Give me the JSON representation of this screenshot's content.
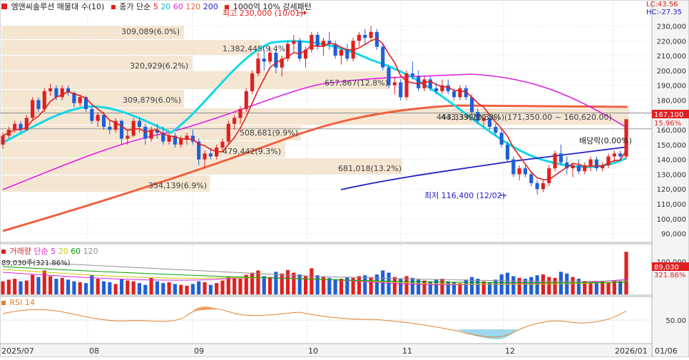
{
  "header": {
    "title": "엠앤씨솔루션 매물대 수(10)",
    "ma_label": "종가 단순",
    "ma_periods": [
      "5",
      "20",
      "60",
      "120",
      "200"
    ],
    "ma_colors": [
      "#e02020",
      "#00d0e0",
      "#e020e0",
      "#f08050",
      "#2020d0"
    ],
    "pattern_label": "1000억 10% 강세패턴"
  },
  "corner": {
    "lc": "LC:43.56",
    "hc": "HC:-27.35"
  },
  "price_axis_ticks": [
    "230,000",
    "220,000",
    "210,000",
    "200,000",
    "190,000",
    "180,000",
    "170,000",
    "160,000",
    "150,000",
    "140,000",
    "130,000",
    "120,000",
    "110,000",
    "100,000",
    "90,000"
  ],
  "last_price": {
    "label": "167,100",
    "pct": "15.96%"
  },
  "annotations": {
    "high": "최고 230,000 (10/01)",
    "low": "최저 116,400 (12/02)",
    "dividend": "배당락(0.00%)",
    "current_box": "443,339(20.3%)(171,350.00 ~ 160,620.00)"
  },
  "volume_profile": [
    {
      "label": "309,089(6.0%)"
    },
    {
      "label": "1,382,445(9.4%)"
    },
    {
      "label": "320,929(6.2%)"
    },
    {
      "label": "657,867(12.8%)"
    },
    {
      "label": "309,879(6.0%)"
    },
    {
      "label": "443,339(20.3%)"
    },
    {
      "label": "508,681(9.9%)"
    },
    {
      "label": "479,442(9.3%)"
    },
    {
      "label": "681,018(13.2%)"
    },
    {
      "label": "354,139(6.9%)"
    }
  ],
  "volume_panel": {
    "title": "거래량",
    "ma_label": "단순",
    "ma_periods": [
      "5",
      "20",
      "60",
      "120"
    ],
    "ma_colors": [
      "#e020e0",
      "#d0d000",
      "#00a000",
      "#909090"
    ],
    "info": "89,030주(321.86%)",
    "axis_label": "100,000",
    "value_label": "89,030",
    "pct_label": "321.86%"
  },
  "rsi_panel": {
    "title": "RSI 14",
    "axis_label": "50.00"
  },
  "x_axis": {
    "labels": [
      "2025/07",
      "08",
      "09",
      "10",
      "11",
      "12",
      "2026/01",
      "01/06"
    ]
  },
  "chart_data": {
    "type": "candlestick",
    "title": "엠앤씨솔루션",
    "ylim": [
      85000,
      236000
    ],
    "high": {
      "value": 230000,
      "date": "10/01"
    },
    "low": {
      "value": 116400,
      "date": "12/02"
    },
    "last_close": 167100,
    "last_change_pct": 15.96,
    "volume_profile_levels": [
      {
        "volume": 309089,
        "pct": 6.0
      },
      {
        "volume": 1382445,
        "pct": 9.4
      },
      {
        "volume": 320929,
        "pct": 6.2
      },
      {
        "volume": 657867,
        "pct": 12.8
      },
      {
        "volume": 309879,
        "pct": 6.0
      },
      {
        "volume": 443339,
        "pct": 20.3,
        "range": [
          160620,
          171350
        ]
      },
      {
        "volume": 508681,
        "pct": 9.9
      },
      {
        "volume": 479442,
        "pct": 9.3
      },
      {
        "volume": 681018,
        "pct": 13.2
      },
      {
        "volume": 354139,
        "pct": 6.9
      }
    ],
    "last_volume": 89030,
    "last_volume_pct": 321.86,
    "candles": [
      [
        150000,
        158000,
        147000,
        156000
      ],
      [
        156000,
        162000,
        154000,
        160000
      ],
      [
        160000,
        166000,
        158000,
        164000
      ],
      [
        164000,
        166000,
        158000,
        160000
      ],
      [
        160000,
        170000,
        159000,
        168000
      ],
      [
        168000,
        182000,
        167000,
        180000
      ],
      [
        180000,
        182000,
        172000,
        174000
      ],
      [
        174000,
        188000,
        172000,
        186000
      ],
      [
        186000,
        191000,
        183000,
        188000
      ],
      [
        188000,
        190000,
        180000,
        182000
      ],
      [
        182000,
        190000,
        180000,
        188000
      ],
      [
        188000,
        190000,
        183000,
        185000
      ],
      [
        185000,
        186000,
        175000,
        178000
      ],
      [
        178000,
        184000,
        176000,
        182000
      ],
      [
        182000,
        183000,
        172000,
        174000
      ],
      [
        174000,
        176000,
        164000,
        166000
      ],
      [
        166000,
        172000,
        162000,
        170000
      ],
      [
        170000,
        172000,
        160000,
        162000
      ],
      [
        162000,
        166000,
        157000,
        160000
      ],
      [
        160000,
        168000,
        158000,
        166000
      ],
      [
        166000,
        167000,
        150000,
        154000
      ],
      [
        154000,
        160000,
        150000,
        156000
      ],
      [
        156000,
        168000,
        155000,
        166000
      ],
      [
        166000,
        168000,
        158000,
        162000
      ],
      [
        162000,
        164000,
        150000,
        154000
      ],
      [
        154000,
        162000,
        152000,
        160000
      ],
      [
        160000,
        164000,
        154000,
        158000
      ],
      [
        158000,
        162000,
        150000,
        152000
      ],
      [
        152000,
        158000,
        150000,
        156000
      ],
      [
        156000,
        158000,
        148000,
        150000
      ],
      [
        150000,
        156000,
        148000,
        154000
      ],
      [
        154000,
        158000,
        150000,
        156000
      ],
      [
        156000,
        160000,
        150000,
        152000
      ],
      [
        152000,
        154000,
        136000,
        140000
      ],
      [
        140000,
        146000,
        134000,
        144000
      ],
      [
        144000,
        148000,
        140000,
        142000
      ],
      [
        142000,
        150000,
        140000,
        148000
      ],
      [
        148000,
        154000,
        146000,
        152000
      ],
      [
        152000,
        166000,
        150000,
        164000
      ],
      [
        164000,
        170000,
        160000,
        168000
      ],
      [
        168000,
        176000,
        164000,
        174000
      ],
      [
        174000,
        188000,
        172000,
        186000
      ],
      [
        186000,
        200000,
        184000,
        198000
      ],
      [
        198000,
        212000,
        196000,
        208000
      ],
      [
        208000,
        214000,
        200000,
        206000
      ],
      [
        206000,
        216000,
        204000,
        212000
      ],
      [
        212000,
        214000,
        198000,
        202000
      ],
      [
        202000,
        210000,
        196000,
        208000
      ],
      [
        208000,
        220000,
        206000,
        218000
      ],
      [
        218000,
        224000,
        212000,
        220000
      ],
      [
        220000,
        222000,
        206000,
        208000
      ],
      [
        208000,
        216000,
        202000,
        214000
      ],
      [
        214000,
        226000,
        212000,
        224000
      ],
      [
        224000,
        226000,
        214000,
        216000
      ],
      [
        216000,
        222000,
        210000,
        220000
      ],
      [
        220000,
        226000,
        214000,
        218000
      ],
      [
        218000,
        220000,
        208000,
        210000
      ],
      [
        210000,
        216000,
        204000,
        214000
      ],
      [
        214000,
        218000,
        206000,
        208000
      ],
      [
        208000,
        222000,
        206000,
        220000
      ],
      [
        220000,
        226000,
        216000,
        224000
      ],
      [
        224000,
        228000,
        218000,
        222000
      ],
      [
        222000,
        230000,
        220000,
        226000
      ],
      [
        226000,
        228000,
        214000,
        216000
      ],
      [
        216000,
        218000,
        200000,
        202000
      ],
      [
        202000,
        204000,
        188000,
        190000
      ],
      [
        190000,
        196000,
        184000,
        192000
      ],
      [
        192000,
        194000,
        180000,
        182000
      ],
      [
        182000,
        200000,
        180000,
        198000
      ],
      [
        198000,
        206000,
        194000,
        196000
      ],
      [
        196000,
        200000,
        186000,
        188000
      ],
      [
        188000,
        196000,
        186000,
        194000
      ],
      [
        194000,
        196000,
        186000,
        188000
      ],
      [
        188000,
        192000,
        184000,
        186000
      ],
      [
        186000,
        194000,
        184000,
        190000
      ],
      [
        190000,
        194000,
        184000,
        186000
      ],
      [
        186000,
        188000,
        180000,
        182000
      ],
      [
        182000,
        190000,
        180000,
        188000
      ],
      [
        188000,
        190000,
        180000,
        182000
      ],
      [
        182000,
        184000,
        170000,
        172000
      ],
      [
        172000,
        174000,
        164000,
        166000
      ],
      [
        166000,
        170000,
        162000,
        168000
      ],
      [
        168000,
        170000,
        160000,
        162000
      ],
      [
        162000,
        164000,
        156000,
        158000
      ],
      [
        158000,
        160000,
        148000,
        150000
      ],
      [
        150000,
        152000,
        138000,
        140000
      ],
      [
        140000,
        142000,
        128000,
        130000
      ],
      [
        130000,
        136000,
        126000,
        134000
      ],
      [
        134000,
        136000,
        128000,
        130000
      ],
      [
        130000,
        132000,
        122000,
        124000
      ],
      [
        124000,
        126000,
        116400,
        120000
      ],
      [
        120000,
        126000,
        118000,
        124000
      ],
      [
        124000,
        136000,
        122000,
        134000
      ],
      [
        134000,
        146000,
        132000,
        144000
      ],
      [
        144000,
        150000,
        136000,
        138000
      ],
      [
        138000,
        142000,
        130000,
        134000
      ],
      [
        134000,
        138000,
        128000,
        136000
      ],
      [
        136000,
        140000,
        130000,
        132000
      ],
      [
        132000,
        138000,
        130000,
        136000
      ],
      [
        136000,
        142000,
        132000,
        140000
      ],
      [
        140000,
        142000,
        132000,
        134000
      ],
      [
        134000,
        138000,
        132000,
        136000
      ],
      [
        136000,
        144000,
        134000,
        142000
      ],
      [
        142000,
        146000,
        138000,
        144000
      ],
      [
        144000,
        146000,
        140000,
        142000
      ],
      [
        142000,
        167100,
        140000,
        167100
      ]
    ],
    "volumes": [
      30,
      34,
      36,
      30,
      32,
      45,
      40,
      55,
      42,
      36,
      38,
      34,
      30,
      28,
      26,
      44,
      36,
      30,
      28,
      24,
      36,
      32,
      30,
      26,
      22,
      38,
      30,
      26,
      28,
      24,
      22,
      20,
      24,
      30,
      28,
      22,
      26,
      32,
      40,
      38,
      36,
      45,
      50,
      55,
      42,
      40,
      52,
      48,
      56,
      50,
      46,
      42,
      60,
      44,
      40,
      38,
      35,
      36,
      40,
      38,
      42,
      44,
      40,
      46,
      55,
      50,
      40,
      36,
      42,
      38,
      34,
      32,
      30,
      34,
      36,
      30,
      28,
      26,
      34,
      40,
      36,
      30,
      28,
      34,
      46,
      50,
      42,
      38,
      36,
      40,
      44,
      46,
      40,
      38,
      52,
      48,
      40,
      36,
      30,
      28,
      26,
      30,
      28,
      32,
      30,
      34,
      98
    ]
  }
}
